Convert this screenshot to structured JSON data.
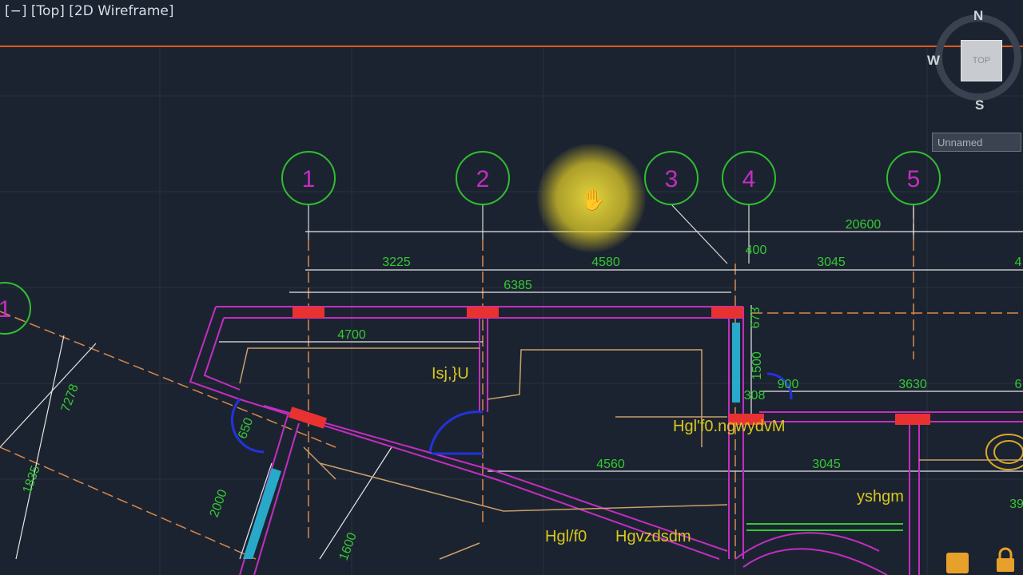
{
  "viewport": {
    "label": "[−] [Top] [2D Wireframe]"
  },
  "viewcube": {
    "north": "N",
    "south": "S",
    "west": "W",
    "face": "TOP",
    "wcs_label": "Unnamed"
  },
  "grid_bubbles": [
    "1",
    "2",
    "3",
    "4",
    "5"
  ],
  "dimensions": {
    "total": "20600",
    "d1": "3225",
    "d2": "4580",
    "d3": "400",
    "d4": "3045",
    "d5": "6385",
    "d6": "4700",
    "d7": "900",
    "d8": "3630",
    "d9": "4560",
    "d10": "3045",
    "d11": "1500",
    "d12": "7278",
    "d13": "650",
    "d14": "2000",
    "d15": "1600",
    "d16": "1835",
    "d17": "4",
    "d18": "6",
    "d19": "39",
    "d20": "673",
    "d21": "308"
  },
  "room_labels": {
    "r1": "Isj,}U",
    "r2": "Hgl'f0.ngwydvM",
    "r3": "yshgm",
    "r4": "Hgl/f0",
    "r5": "Hgvzdsdm"
  },
  "colors": {
    "background": "#1c2330",
    "grid_bubble": "#2fbf2f",
    "grid_number": "#c22ec2",
    "wall": "#c22ec2",
    "dimension_text": "#34c934",
    "annotation": "#d7c81f",
    "center_line": "#d98a4a",
    "orange_rule": "#e05a1a"
  }
}
